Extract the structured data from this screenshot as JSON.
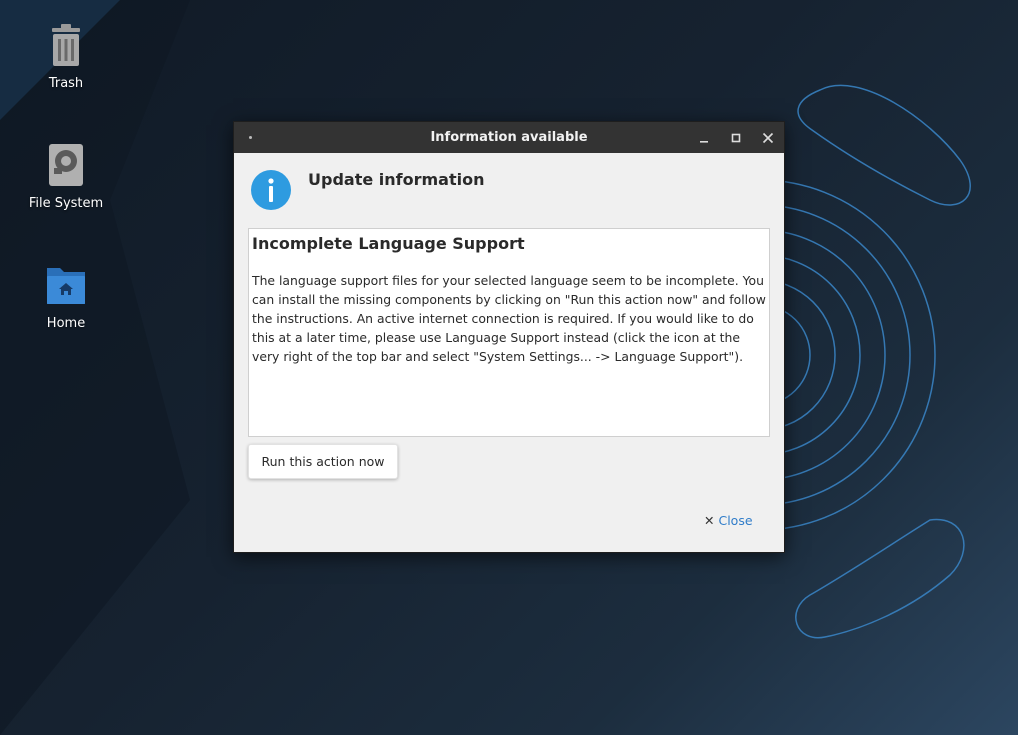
{
  "desktop": {
    "icons": [
      {
        "label": "Trash",
        "icon": "trash-icon"
      },
      {
        "label": "File System",
        "icon": "drive-icon"
      },
      {
        "label": "Home",
        "icon": "home-folder-icon"
      }
    ]
  },
  "dialog": {
    "title": "Information available",
    "header": "Update information",
    "heading": "Incomplete Language Support",
    "body": "The language support files for your selected language seem to be incomplete. You can install the missing components by clicking on \"Run this action now\" and follow the instructions. An active internet connection is required. If you would like to do this at a later time, please use Language Support instead (click the icon at the very right of the top bar and select \"System Settings... -> Language Support\").",
    "action_label": "Run this action now",
    "close_label": "Close",
    "controls": {
      "minimize": "minimize-icon",
      "maximize": "maximize-icon",
      "close": "close-icon"
    },
    "info_icon": "info-icon",
    "accent": "#2f7cc9",
    "info_color": "#2e9be0"
  }
}
